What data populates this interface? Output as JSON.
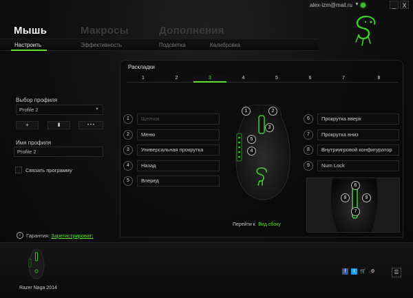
{
  "titlebar": {
    "email": "alex-izm@mail.ru",
    "arrow": "▼",
    "minimize": "_",
    "close": "X"
  },
  "nav": {
    "main": [
      {
        "label": "Мышь",
        "active": true
      },
      {
        "label": "Макросы",
        "active": false
      },
      {
        "label": "Дополнения",
        "active": false
      }
    ],
    "sub": [
      {
        "label": "Настроить",
        "active": true
      },
      {
        "label": "Эффективность",
        "active": false
      },
      {
        "label": "Подсветка",
        "active": false
      },
      {
        "label": "Калибровка",
        "active": false
      }
    ]
  },
  "left": {
    "profile_select_label": "Выбор профиля",
    "profile_select_value": "Profile 2",
    "dropdown_arrow": "▼",
    "add_btn": "+",
    "delete_btn": "▮",
    "more_btn": "• • •",
    "profile_name_label": "Имя профиля",
    "profile_name_value": "Profile 2",
    "link_program_label": "Связать программу",
    "warranty_label": "Гарантия:",
    "warranty_link": "Зарегистрироват:"
  },
  "panel": {
    "title": "Раскладки",
    "tabs": [
      "1",
      "2",
      "3",
      "4",
      "5",
      "6",
      "7",
      "8"
    ],
    "selected_tab": "3",
    "left_buttons": [
      {
        "num": "1",
        "label": "Щелчок"
      },
      {
        "num": "2",
        "label": "Меню"
      },
      {
        "num": "3",
        "label": "Универсальная прокрутка"
      },
      {
        "num": "4",
        "label": "Назад"
      },
      {
        "num": "5",
        "label": "Вперед"
      }
    ],
    "right_buttons": [
      {
        "num": "6",
        "label": "Прокрутка вверх"
      },
      {
        "num": "7",
        "label": "Прокрутка вниз"
      },
      {
        "num": "8",
        "label": "Внутриигровой конфигуратор"
      },
      {
        "num": "9",
        "label": "Num Lock"
      }
    ],
    "mouse_labels": [
      "1",
      "2",
      "3",
      "5",
      "4"
    ],
    "side_labels": [
      "6",
      "8",
      "9",
      "7"
    ],
    "side_view_text": "Перейти к",
    "side_view_link": "Вид сбоку"
  },
  "bottom": {
    "device_name": "Razer Naga 2014",
    "social": [
      "f",
      "t",
      "🛒",
      "⚙"
    ],
    "menu_icon": "☰"
  },
  "colors": {
    "accent": "#5fe02f",
    "background": "#0a0a0a"
  }
}
